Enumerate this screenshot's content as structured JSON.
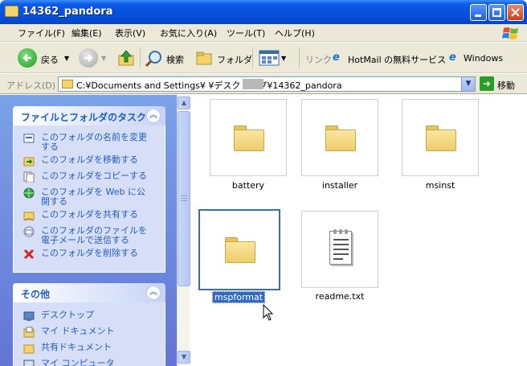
{
  "window": {
    "title": "14362_pandora"
  },
  "menu": [
    "ファイル(F)",
    "編集(E)",
    "表示(V)",
    "お気に入り(A)",
    "ツール(T)",
    "ヘルプ(H)"
  ],
  "toolbar": {
    "back": "戻る",
    "search": "検索",
    "folders": "フォルダ",
    "links_label": "リンク",
    "link1": "HotMail の無料サービス",
    "link2": "Windows"
  },
  "address": {
    "label": "アドレス(D)",
    "value": "C:¥Documents and Settings¥      ¥デスクトップ¥14362_pandora",
    "go": "移動"
  },
  "tasks_panel": {
    "title": "ファイルとフォルダのタスク",
    "items": [
      "このフォルダの名前を変更する",
      "このフォルダを移動する",
      "このフォルダをコピーする",
      "このフォルダを Web に公開する",
      "このフォルダを共有する",
      "このフォルダのファイルを電子メールで送信する",
      "このフォルダを削除する"
    ]
  },
  "other_panel": {
    "title": "その他",
    "items": [
      "デスクトップ",
      "マイ ドキュメント",
      "共有ドキュメント",
      "マイ コンピュータ"
    ]
  },
  "files": [
    {
      "name": "battery",
      "type": "folder"
    },
    {
      "name": "installer",
      "type": "folder"
    },
    {
      "name": "msinst",
      "type": "folder"
    },
    {
      "name": "mspformat",
      "type": "folder",
      "selected": true
    },
    {
      "name": "readme.txt",
      "type": "text"
    }
  ]
}
